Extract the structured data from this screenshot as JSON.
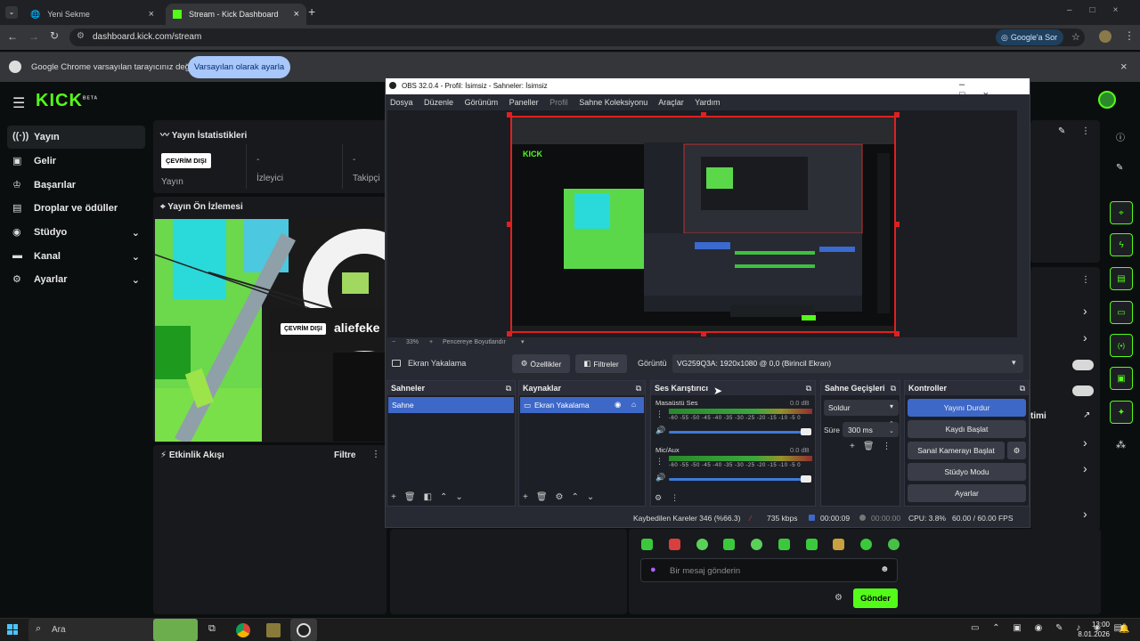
{
  "browser": {
    "tabs": [
      {
        "title": "Yeni Sekme"
      },
      {
        "title": "Stream - Kick Dashboard"
      }
    ],
    "url": "dashboard.kick.com/stream",
    "google_btn": "Google'a Sor",
    "infobar_text": "Google Chrome varsayılan tarayıcınız değil",
    "infobar_button": "Varsayılan olarak ayarla"
  },
  "kick": {
    "logo": "KICK",
    "logo_badge": "BETA",
    "nav": [
      {
        "label": "Yayın",
        "icon": "broadcast-icon"
      },
      {
        "label": "Gelir",
        "icon": "money-icon"
      },
      {
        "label": "Başarılar",
        "icon": "trophy-icon"
      },
      {
        "label": "Droplar ve ödüller",
        "icon": "gift-icon"
      },
      {
        "label": "Stüdyo",
        "icon": "studio-icon"
      },
      {
        "label": "Kanal",
        "icon": "channel-icon"
      },
      {
        "label": "Ayarlar",
        "icon": "gear-icon"
      }
    ],
    "stats_title": "Yayın İstatistikleri",
    "offline_badge": "ÇEVRİM DIŞI",
    "stat_labels": [
      "Yayın",
      "İzleyici",
      "Takipçi"
    ],
    "stat_values": [
      "-",
      "-"
    ],
    "preview_title": "Yayın Ön İzlemesi",
    "preview_badge": "ÇEVRİM DIŞI",
    "preview_name": "aliefeke",
    "activity_title": "Etkinlik Akışı",
    "filter_label": "Filtre",
    "right_text": "timi",
    "chat_placeholder": "Bir mesaj gönderin",
    "send_button": "Gönder",
    "accent": "#53fc18"
  },
  "obs": {
    "title": "OBS 32.0.4 - Profil: İsimsiz - Sahneler: İsimsiz",
    "menu": [
      "Dosya",
      "Düzenle",
      "Görünüm",
      "Paneller",
      "Profil",
      "Sahne Koleksiyonu",
      "Araçlar",
      "Yardım"
    ],
    "zoom": "33%",
    "fit_label": "Pencereye Boyutlandır",
    "source_name": "Ekran Yakalama",
    "properties_btn": "Özellikler",
    "filters_btn": "Filtreler",
    "display_label": "Görüntü",
    "display_value": "VG259Q3A: 1920x1080 @ 0,0 (Birincil Ekran)",
    "docks": {
      "scenes": {
        "title": "Sahneler",
        "items": [
          "Sahne"
        ]
      },
      "sources": {
        "title": "Kaynaklar",
        "items": [
          "Ekran Yakalama"
        ]
      },
      "mixer": {
        "title": "Ses Karıştırıcı",
        "tracks": [
          {
            "name": "Masaüstü Ses",
            "db": "0.0 dB"
          },
          {
            "name": "Mic/Aux",
            "db": "0.0 dB"
          }
        ],
        "scale": "-60 -55 -50 -45 -40 -35 -30 -25 -20 -15 -10 -5 0"
      },
      "transitions": {
        "title": "Sahne Geçişleri",
        "type": "Soldur",
        "duration_label": "Süre",
        "duration": "300 ms"
      },
      "controls": {
        "title": "Kontroller",
        "buttons": [
          "Yayını Durdur",
          "Kaydı Başlat",
          "Sanal Kamerayı Başlat",
          "Stüdyo Modu",
          "Ayarlar"
        ]
      }
    },
    "status": {
      "dropped": "Kaybedilen Kareler 346 (%66.3)",
      "bitrate": "735 kbps",
      "stream_time": "00:00:09",
      "rec_time": "00:00:00",
      "cpu": "CPU: 3.8%",
      "fps": "60.00 / 60.00 FPS"
    }
  },
  "taskbar": {
    "search": "Ara",
    "time": "13:00",
    "date": "8.01.2026"
  }
}
